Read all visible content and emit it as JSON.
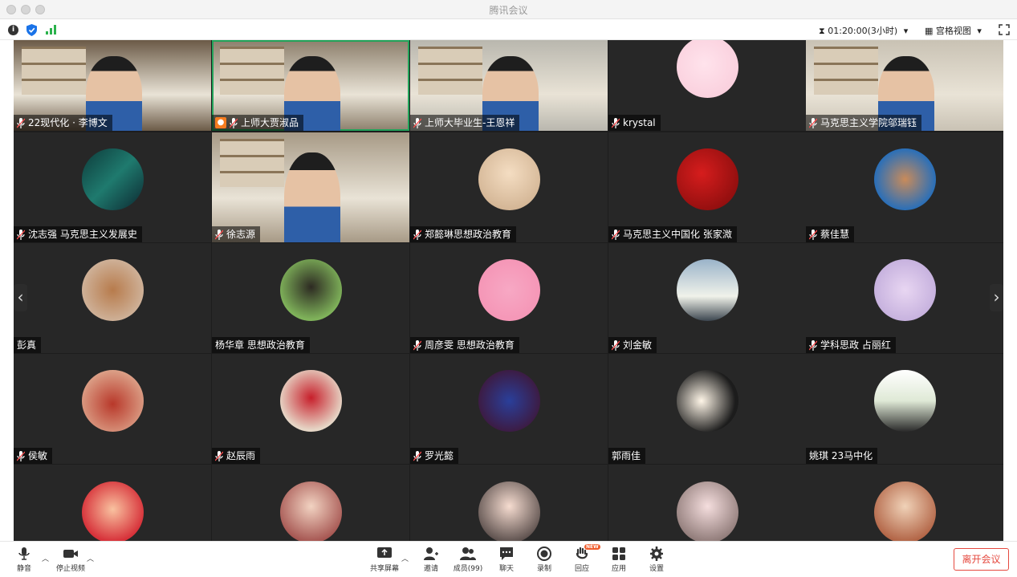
{
  "window": {
    "title": "腾讯会议"
  },
  "infobar": {
    "timer": "01:20:00(3小时)",
    "view_mode": "宫格视图"
  },
  "participants": [
    {
      "name": "22现代化 · 李博文"
    },
    {
      "name": "上师大贾淑品"
    },
    {
      "name": "上师大毕业生-王恩祥"
    },
    {
      "name": "krystal"
    },
    {
      "name": "马克思主义学院邬瑞钰"
    },
    {
      "name": "沈志强  马克思主义发展史"
    },
    {
      "name": "徐志源"
    },
    {
      "name": "郑懿琳思想政治教育"
    },
    {
      "name": "马克思主义中国化 张家溦"
    },
    {
      "name": "蔡佳慧"
    },
    {
      "name": "彭真"
    },
    {
      "name": "杨华章 思想政治教育"
    },
    {
      "name": "周彦雯 思想政治教育"
    },
    {
      "name": "刘金敏"
    },
    {
      "name": "学科思政 占丽红"
    },
    {
      "name": "侯敏"
    },
    {
      "name": "赵辰雨"
    },
    {
      "name": "罗光懿"
    },
    {
      "name": "郭雨佳"
    },
    {
      "name": "姚琪 23马中化"
    }
  ],
  "toolbar": {
    "mute": "静音",
    "stop_video": "停止视频",
    "share_screen": "共享屏幕",
    "invite": "邀请",
    "members": "成员(99)",
    "chat": "聊天",
    "record": "录制",
    "react": "回应",
    "react_badge": "NEW",
    "apps": "应用",
    "settings": "设置",
    "leave": "离开会议"
  },
  "colors": {
    "active_speaker": "#22a35a",
    "leave": "#e5493f",
    "grid_bg": "#1d1d1d"
  }
}
